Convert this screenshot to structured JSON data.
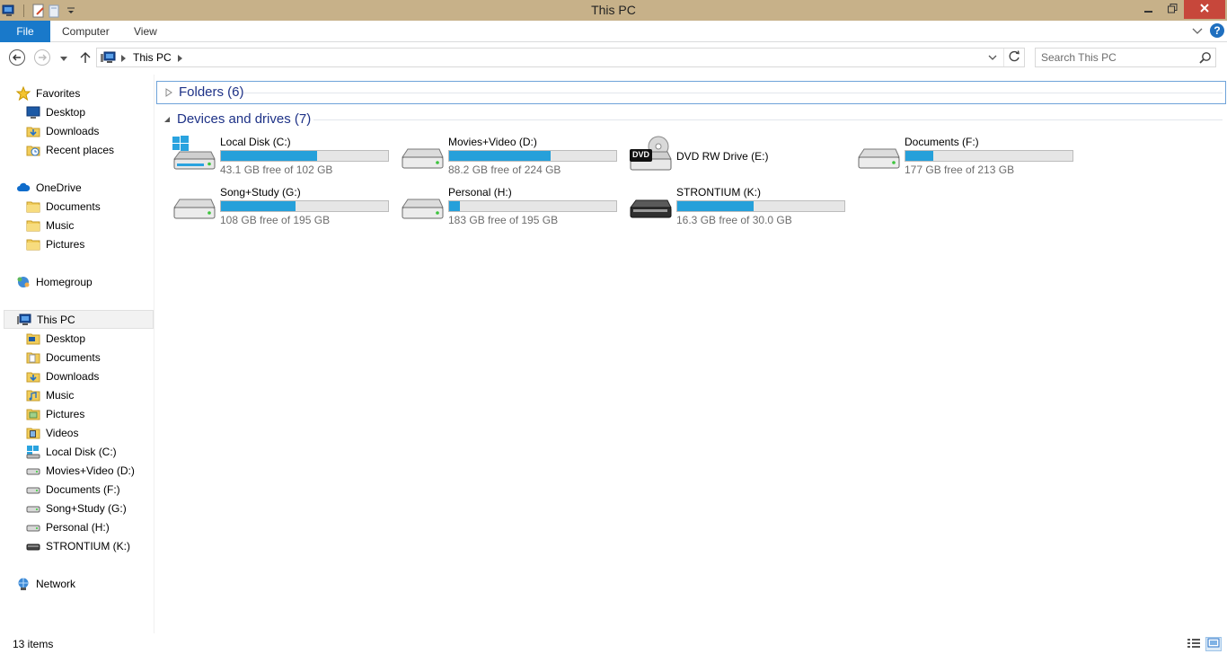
{
  "window": {
    "title": "This PC"
  },
  "ribbon": {
    "file": "File",
    "computer": "Computer",
    "view": "View",
    "help": "?"
  },
  "address": {
    "location": "This PC"
  },
  "search": {
    "placeholder": "Search This PC"
  },
  "sidebar": {
    "favorites": {
      "label": "Favorites",
      "items": [
        "Desktop",
        "Downloads",
        "Recent places"
      ]
    },
    "onedrive": {
      "label": "OneDrive",
      "items": [
        "Documents",
        "Music",
        "Pictures"
      ]
    },
    "homegroup": {
      "label": "Homegroup"
    },
    "thispc": {
      "label": "This PC",
      "items": [
        "Desktop",
        "Documents",
        "Downloads",
        "Music",
        "Pictures",
        "Videos",
        "Local Disk (C:)",
        "Movies+Video (D:)",
        "Documents (F:)",
        "Song+Study (G:)",
        "Personal (H:)",
        "STRONTIUM (K:)"
      ]
    },
    "network": {
      "label": "Network"
    }
  },
  "groups": {
    "folders": "Folders (6)",
    "devices": "Devices and drives (7)"
  },
  "drives": [
    {
      "name": "Local Disk (C:)",
      "free": "43.1 GB free of 102 GB",
      "used_fraction": 0.577,
      "icon": "windows-drive-icon"
    },
    {
      "name": "Movies+Video (D:)",
      "free": "88.2 GB free of 224 GB",
      "used_fraction": 0.606,
      "icon": "hard-drive-icon"
    },
    {
      "name": "DVD RW Drive (E:)",
      "free": "",
      "used_fraction": null,
      "icon": "dvd-drive-icon",
      "badge": "DVD"
    },
    {
      "name": "Documents (F:)",
      "free": "177 GB free of 213 GB",
      "used_fraction": 0.169,
      "icon": "hard-drive-icon"
    },
    {
      "name": "Song+Study (G:)",
      "free": "108 GB free of 195 GB",
      "used_fraction": 0.446,
      "icon": "hard-drive-icon"
    },
    {
      "name": "Personal (H:)",
      "free": "183 GB free of 195 GB",
      "used_fraction": 0.062,
      "icon": "hard-drive-icon"
    },
    {
      "name": "STRONTIUM (K:)",
      "free": "16.3 GB free of 30.0 GB",
      "used_fraction": 0.457,
      "icon": "usb-drive-icon"
    }
  ],
  "status": {
    "items": "13 items"
  },
  "colors": {
    "title_bar": "#c7b189",
    "file_tab": "#1979ca",
    "close_button": "#c7473b",
    "usage_bar": "#26a0da",
    "group_header": "#1e3287"
  }
}
